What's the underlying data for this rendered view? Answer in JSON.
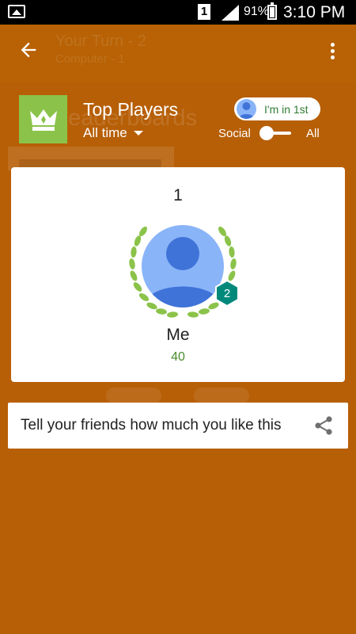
{
  "status_bar": {
    "sim_slot": "1",
    "battery": "91%",
    "time": "3:10 PM"
  },
  "app_bar": {
    "title": "Your Turn - 2",
    "subtitle": "Computer - 1"
  },
  "leaderboard": {
    "background_label": "Leaderboards",
    "title": "Top Players",
    "period": "All time",
    "rank_chip": "I'm in 1st",
    "toggle": {
      "left_label": "Social",
      "right_label": "All",
      "selected": "Social"
    }
  },
  "player": {
    "rank": "1",
    "name": "Me",
    "score": "40",
    "level": "2"
  },
  "share": {
    "label": "Tell your friends how much you like this"
  },
  "colors": {
    "background": "#b75f07",
    "accent_green": "#8bc34a",
    "score_green": "#4a8c2a",
    "avatar_blue": "#8ab4f8",
    "level_badge": "#00897b"
  }
}
